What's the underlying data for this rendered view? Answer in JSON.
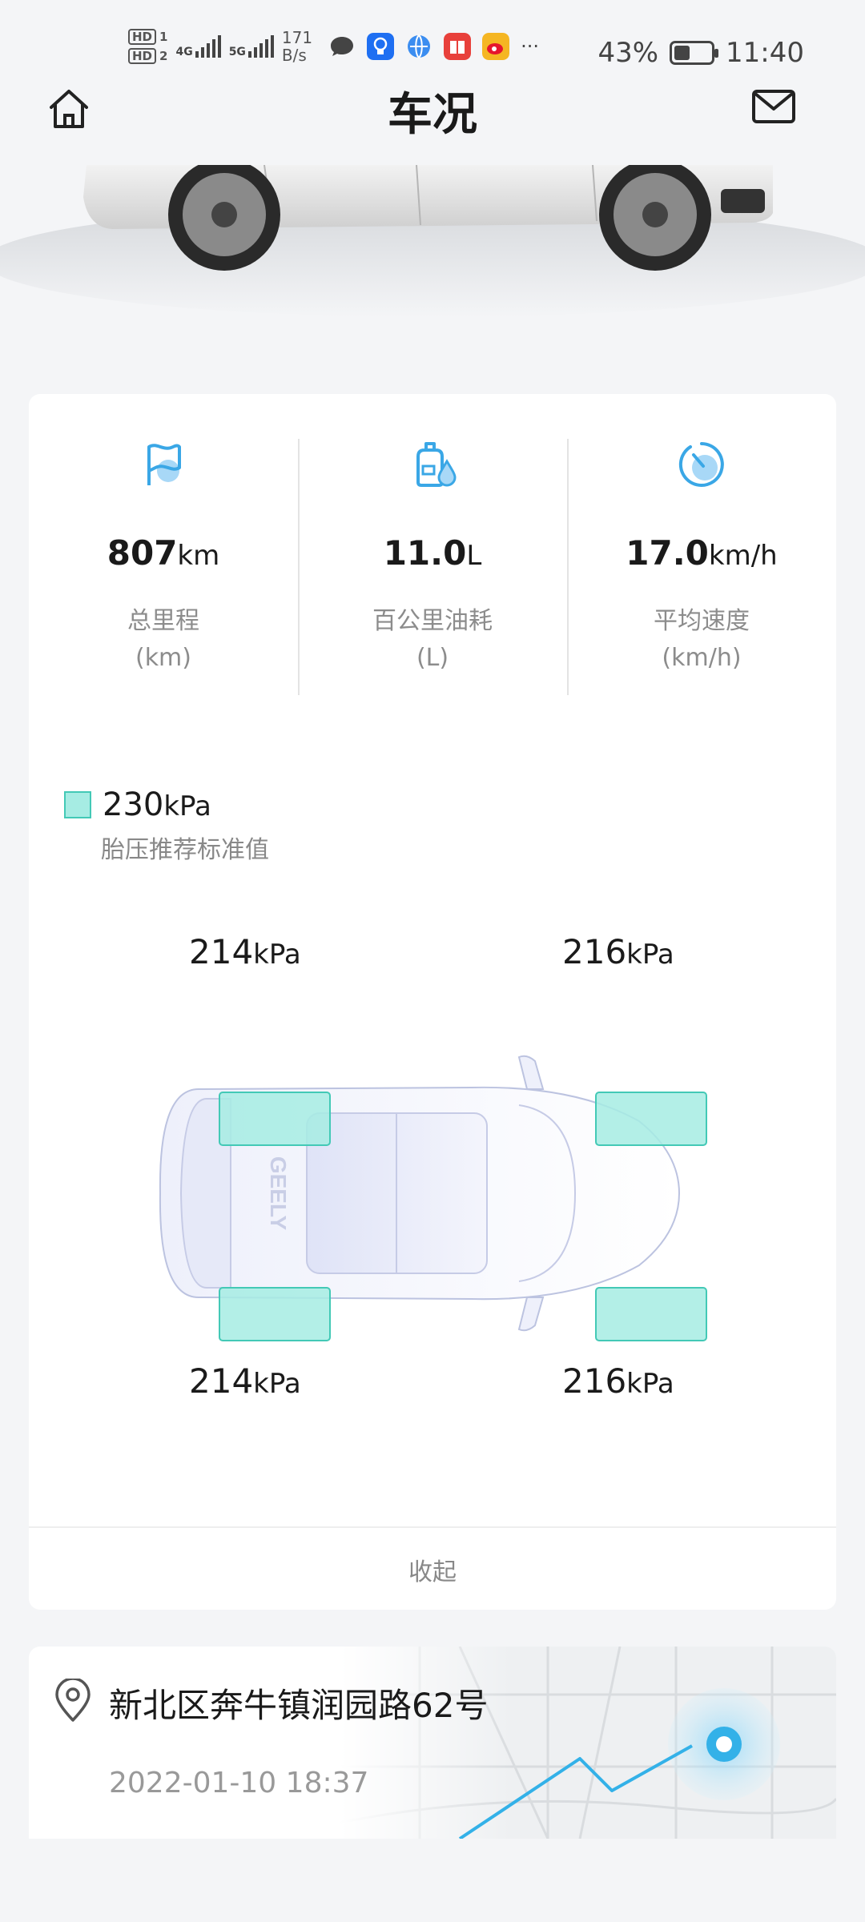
{
  "status_bar": {
    "hd1": "HD",
    "sim1": "1",
    "hd2": "HD",
    "sim2": "2",
    "net1": "4G",
    "net2": "5G",
    "speed_value": "171",
    "speed_unit": "B/s",
    "more": "···",
    "battery": "43%",
    "battery_level": 0.43,
    "time": "11:40"
  },
  "header": {
    "title": "车况",
    "home_icon": "home-icon",
    "mail_icon": "mail-icon"
  },
  "stats": [
    {
      "icon": "flag-icon",
      "value": "807",
      "unit": "km",
      "label": "总里程",
      "sublabel": "(km)"
    },
    {
      "icon": "fuel-icon",
      "value": "11.0",
      "unit": "L",
      "label": "百公里油耗",
      "sublabel": "(L)"
    },
    {
      "icon": "speed-icon",
      "value": "17.0",
      "unit": "km/h",
      "label": "平均速度",
      "sublabel": "(km/h)"
    }
  ],
  "tire_pressure": {
    "recommended_value": "230",
    "recommended_unit": "kPa",
    "recommended_label": "胎压推荐标准值",
    "front_left": "214",
    "front_right": "216",
    "rear_left": "214",
    "rear_right": "216",
    "unit": "kPa",
    "car_badge": "GEELY",
    "highlight_color": "#a6ece3"
  },
  "collapse_label": "收起",
  "location": {
    "address": "新北区奔牛镇润园路62号",
    "datetime": "2022-01-10 18:37"
  },
  "colors": {
    "accent_blue": "#3aa7e6",
    "tire_teal": "#43c9b6",
    "background": "#f4f5f7"
  }
}
